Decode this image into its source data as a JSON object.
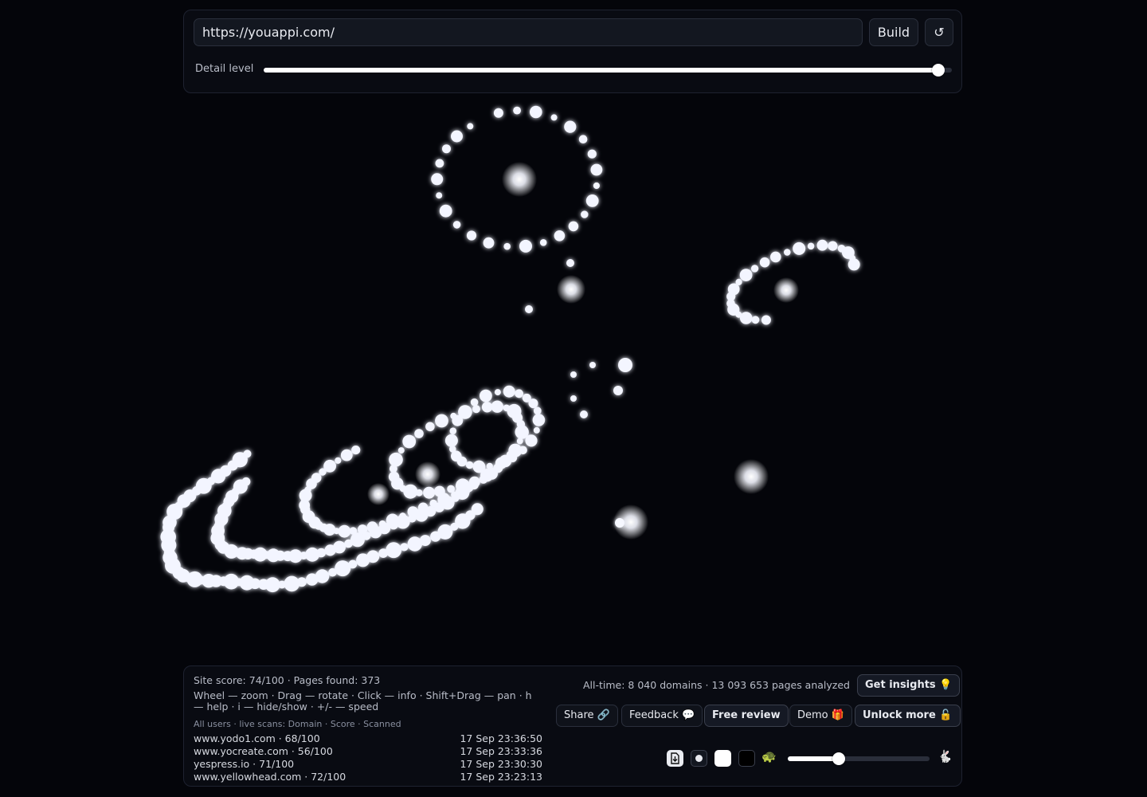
{
  "browser": {
    "url_value": "https://youappi.com/",
    "build_label": "Build",
    "reset_label": "↺"
  },
  "detail": {
    "label": "Detail level",
    "value_fraction": 0.98
  },
  "stats": {
    "site_line": "Site score: 74/100 · Pages found: 373",
    "help_text": "Wheel — zoom · Drag — rotate · Click — info · Shift+Drag — pan · h — help · i — hide/show · +/- — speed",
    "alltime": "All-time: 8 040 domains · 13 093 653 pages analyzed"
  },
  "scans": {
    "header": "All users · live scans: Domain · Score · Scanned",
    "rows": [
      {
        "domain": "www.yodo1.com · 68/100",
        "time": "17 Sep 23:36:50"
      },
      {
        "domain": "www.yocreate.com · 56/100",
        "time": "17 Sep 23:33:36"
      },
      {
        "domain": "yespress.io · 71/100",
        "time": "17 Sep 23:30:30"
      },
      {
        "domain": "www.yellowhead.com · 72/100",
        "time": "17 Sep 23:23:13"
      }
    ]
  },
  "actions": {
    "insights": "Get insights 💡",
    "share": "Share 🔗",
    "feedback": "Feedback 💬",
    "review": "Free review",
    "demo": "Demo 🎁",
    "unlock": "Unlock more 🔓"
  },
  "playback": {
    "slow_icon": "🐢",
    "fast_icon": "🐇",
    "speed_fraction": 0.36
  }
}
